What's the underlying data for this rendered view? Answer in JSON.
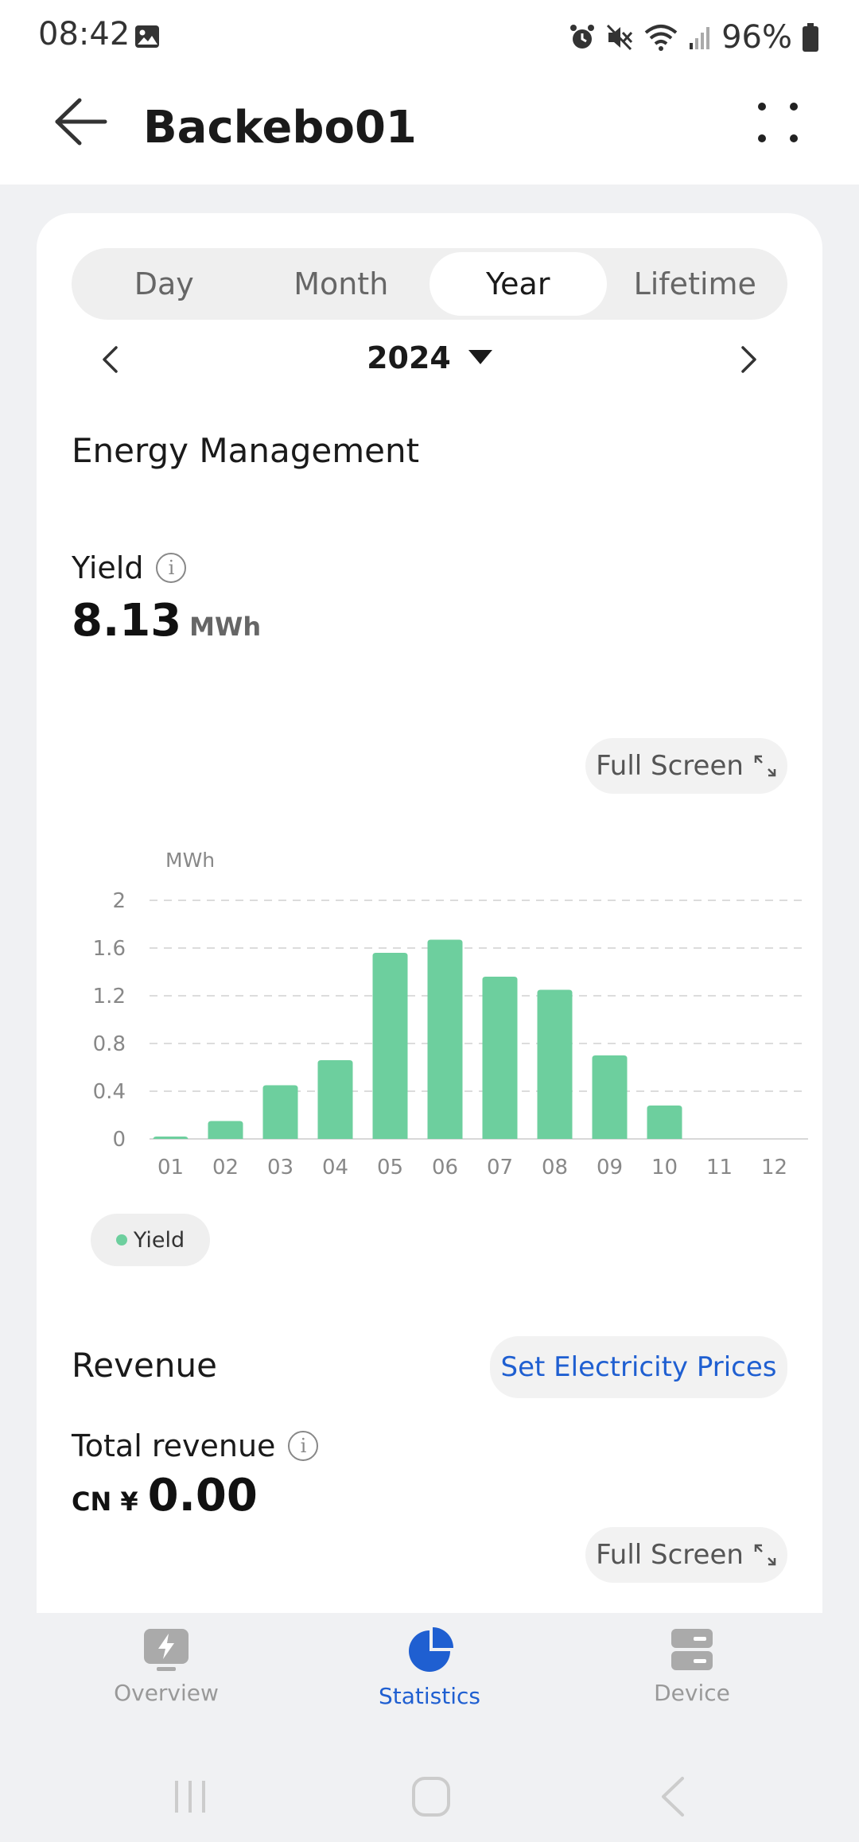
{
  "status": {
    "time": "08:42",
    "battery": "96%"
  },
  "header": {
    "title": "Backebo01"
  },
  "period_tabs": [
    {
      "label": "Day",
      "active": false
    },
    {
      "label": "Month",
      "active": false
    },
    {
      "label": "Year",
      "active": true
    },
    {
      "label": "Lifetime",
      "active": false
    }
  ],
  "date_selector": {
    "value": "2024"
  },
  "energy": {
    "section_title": "Energy Management",
    "yield_label": "Yield",
    "yield_value": "8.13",
    "yield_unit": "MWh",
    "fullscreen_label": "Full Screen"
  },
  "chart_data": {
    "type": "bar",
    "ylabel": "MWh",
    "ylim": [
      0,
      2
    ],
    "yticks": [
      "0",
      "0.4",
      "0.8",
      "1.2",
      "1.6",
      "2"
    ],
    "categories": [
      "01",
      "02",
      "03",
      "04",
      "05",
      "06",
      "07",
      "08",
      "09",
      "10",
      "11",
      "12"
    ],
    "series": [
      {
        "name": "Yield",
        "values": [
          0.02,
          0.15,
          0.45,
          0.66,
          1.56,
          1.67,
          1.36,
          1.25,
          0.7,
          0.28,
          0,
          0
        ]
      }
    ],
    "grid": true,
    "legend": "bottom-left",
    "color": "#6dcf9e"
  },
  "revenue": {
    "section_title": "Revenue",
    "set_prices_label": "Set Electricity Prices",
    "total_label": "Total revenue",
    "currency": "CN ¥",
    "total_value": "0.00",
    "fullscreen_label": "Full Screen"
  },
  "bottom_nav": [
    {
      "label": "Overview",
      "icon": "overview-icon",
      "active": false
    },
    {
      "label": "Statistics",
      "icon": "statistics-icon",
      "active": true
    },
    {
      "label": "Device",
      "icon": "device-icon",
      "active": false
    }
  ],
  "colors": {
    "accent": "#1f5fd1",
    "bar": "#6dcf9e"
  }
}
